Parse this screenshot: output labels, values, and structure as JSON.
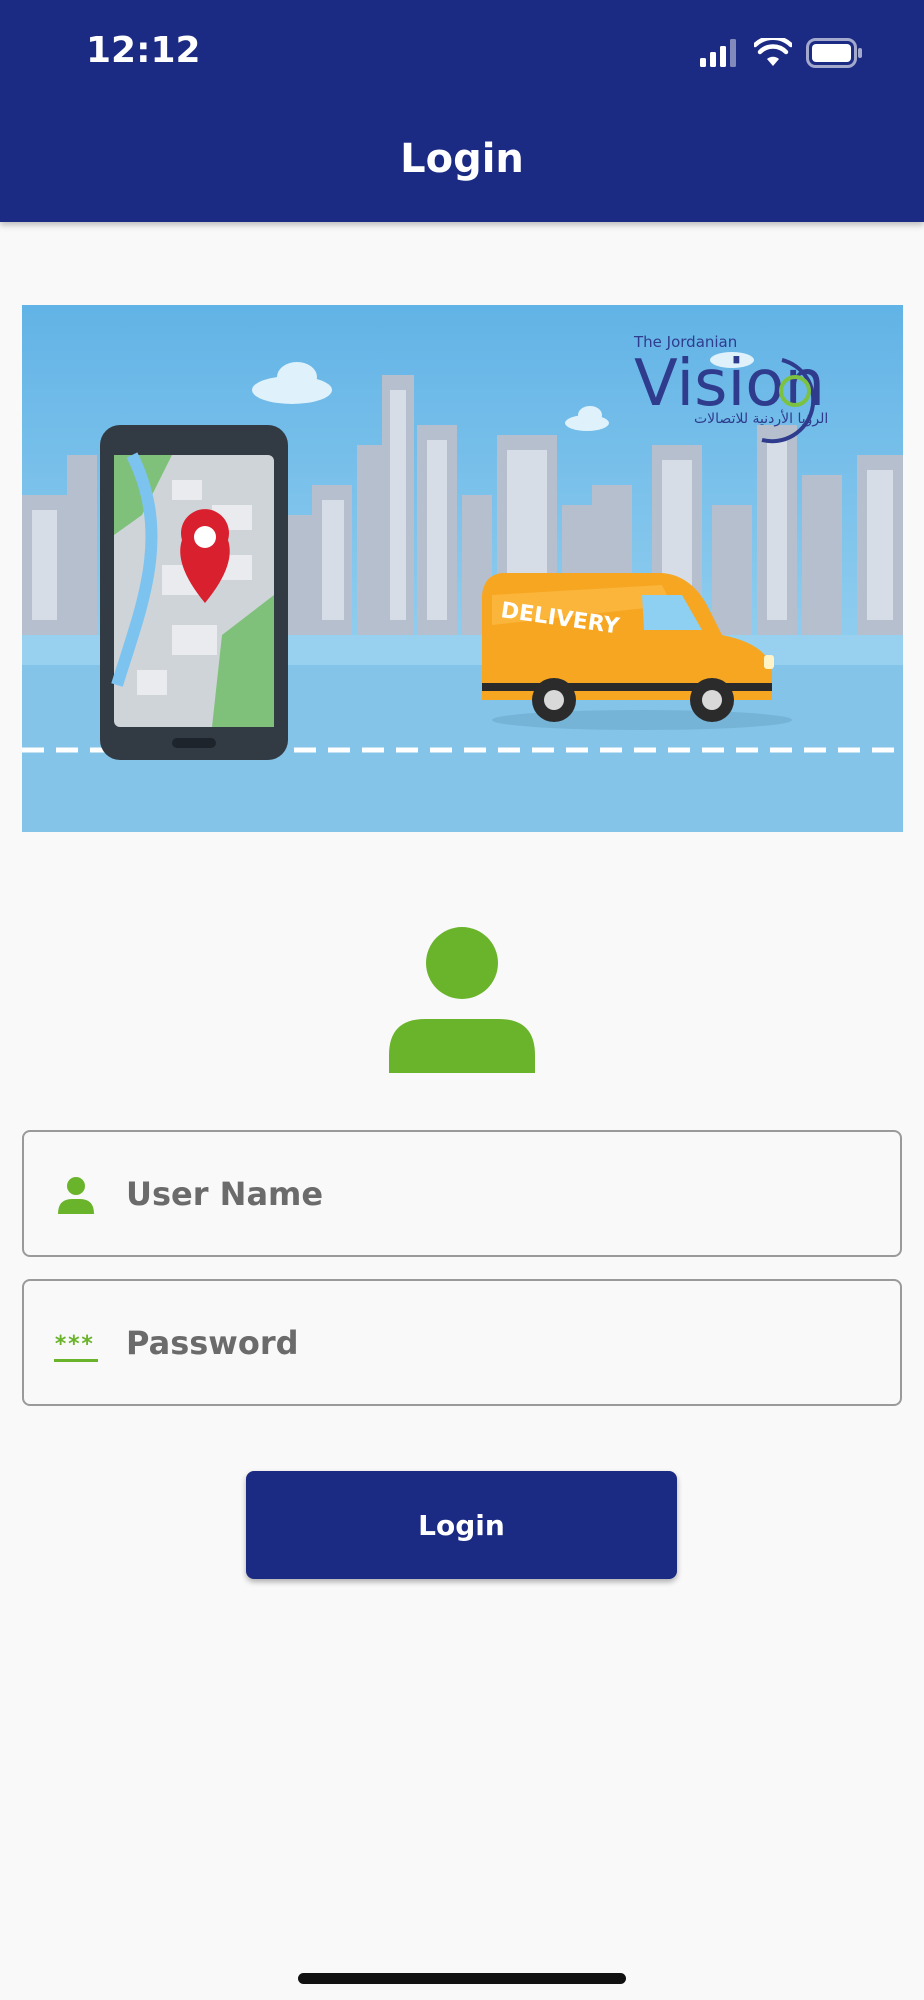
{
  "status_bar": {
    "time": "12:12"
  },
  "header": {
    "title": "Login"
  },
  "banner": {
    "brand_small": "The Jordanian",
    "brand_main": "Vision",
    "brand_arabic": "الرؤيا الأردنية للاتصالات",
    "van_text": "DELIVERY"
  },
  "form": {
    "username_placeholder": "User Name",
    "password_placeholder": "Password",
    "password_icon_glyph": "***",
    "login_label": "Login"
  },
  "colors": {
    "primary": "#1b2a83",
    "accent_green": "#6ab42b",
    "background": "#f9f9f9"
  }
}
